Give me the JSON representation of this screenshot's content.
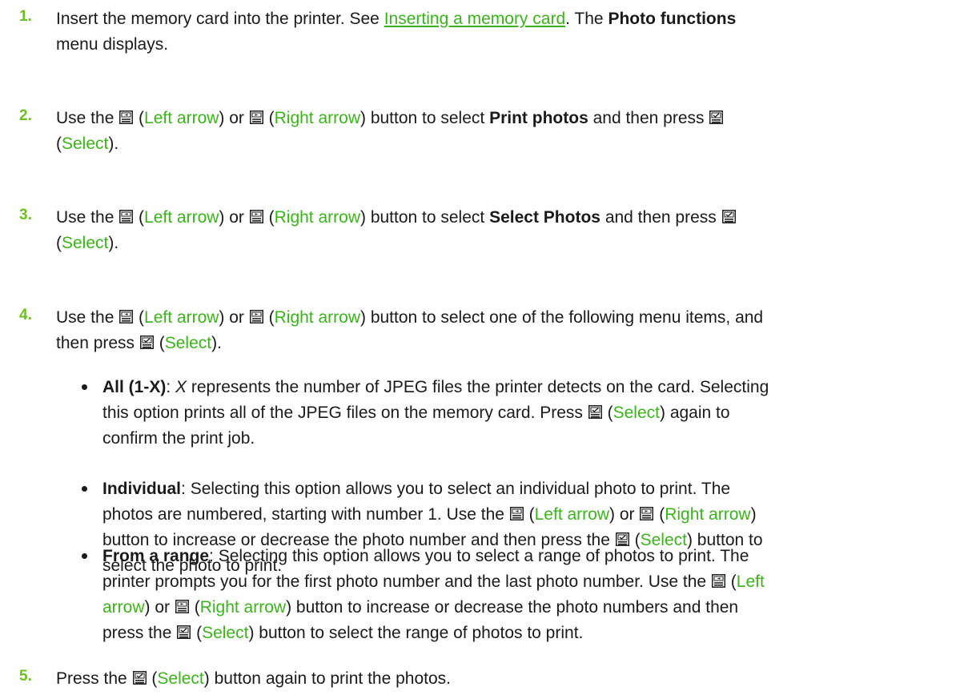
{
  "steps": [
    {
      "number": "1.",
      "a": "Insert the memory card into the printer. See ",
      "link": "Inserting a memory card",
      "b": ". The ",
      "bold": "Photo functions",
      "c": "menu displays."
    },
    {
      "number": "2.",
      "use_the": "Use the",
      "left_label": "Left arrow",
      "or": "or",
      "right_label": "Right arrow",
      "button_to_select": "button to select",
      "bold": "Print photos",
      "and_then_press": "and then press",
      "select_label": "Select"
    },
    {
      "number": "3.",
      "use_the": "Use the",
      "left_label": "Left arrow",
      "or": "or",
      "right_label": "Right arrow",
      "button_to_select": "button to select",
      "bold": "Select Photos",
      "and_then_press": "and then press",
      "select_label": "Select"
    },
    {
      "number": "4.",
      "use_the": "Use the",
      "left_label": "Left arrow",
      "or": "or",
      "right_label": "Right arrow",
      "rest": "button to select one of the following menu items, and",
      "then_press": "then press",
      "select_label": "Select"
    },
    {
      "number": "5.",
      "press_the": "Press the",
      "select_label": "Select",
      "rest": "button again to print the photos."
    }
  ],
  "bullets": [
    {
      "bold": "All (1-X)",
      "italic": "X",
      "line1": "represents the number of JPEG files the printer detects on the card. Selecting",
      "line2a": "this option prints all of the JPEG files on the memory card. Press",
      "select_label": "Select",
      "line2b": "again to",
      "line3": "confirm the print job."
    },
    {
      "bold": "Individual",
      "line1": "Selecting this option allows you to select an individual photo to print. The",
      "line2a": "photos are numbered, starting with number 1. Use the",
      "left_label": "Left arrow",
      "or": "or",
      "right_label": "Right arrow",
      "line3a": "button to increase or decrease the photo number and then press the",
      "select_label": "Select",
      "line3b": "button to",
      "line4": "select the photo to print."
    },
    {
      "bold": "From a range",
      "line1": "Selecting this option allows you to select a range of photos to print. The",
      "line2a": "printer prompts you for the first photo number and the last photo number. Use the",
      "left_part1": "Left",
      "left_part2": "arrow",
      "or": "or",
      "right_label": "Right arrow",
      "line3": "button to increase or decrease the photo numbers and then",
      "line4a": "press the",
      "select_label": "Select",
      "line4b": "button to select the range of photos to print."
    }
  ],
  "icons": {
    "left": "left-arrow-button-icon",
    "right": "right-arrow-button-icon",
    "select": "select-button-icon"
  },
  "colors": {
    "number": "#6bbf1e",
    "green_text": "#3cb31c",
    "text": "#1a1a1a"
  }
}
